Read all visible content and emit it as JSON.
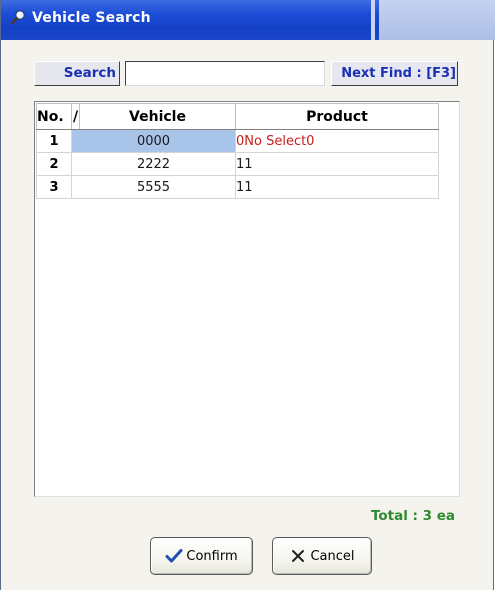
{
  "window": {
    "title": "Vehicle Search",
    "title_icon": "magnifier-icon"
  },
  "search": {
    "label": "Search",
    "value": "",
    "next_find_label": "Next Find : [F3]"
  },
  "table": {
    "columns": [
      "No.",
      "/",
      "Vehicle",
      "Product"
    ],
    "rows": [
      {
        "no": "1",
        "vehicle": "0000",
        "product": "0No Select0",
        "selected": true
      },
      {
        "no": "2",
        "vehicle": "2222",
        "product": "11",
        "selected": false
      },
      {
        "no": "3",
        "vehicle": "5555",
        "product": "11",
        "selected": false
      }
    ]
  },
  "footer": {
    "total": "Total : 3 ea"
  },
  "buttons": {
    "confirm_label": "Confirm",
    "confirm_icon": "checkmark-icon",
    "cancel_label": "Cancel",
    "cancel_icon": "x-icon"
  },
  "colors": {
    "title_bar": "#1d4cd6",
    "label_text": "#1b2fb5",
    "selected_cell": "#a8c4e8",
    "selected_product_text": "#c81e1e",
    "total_text": "#2f8a2f"
  }
}
